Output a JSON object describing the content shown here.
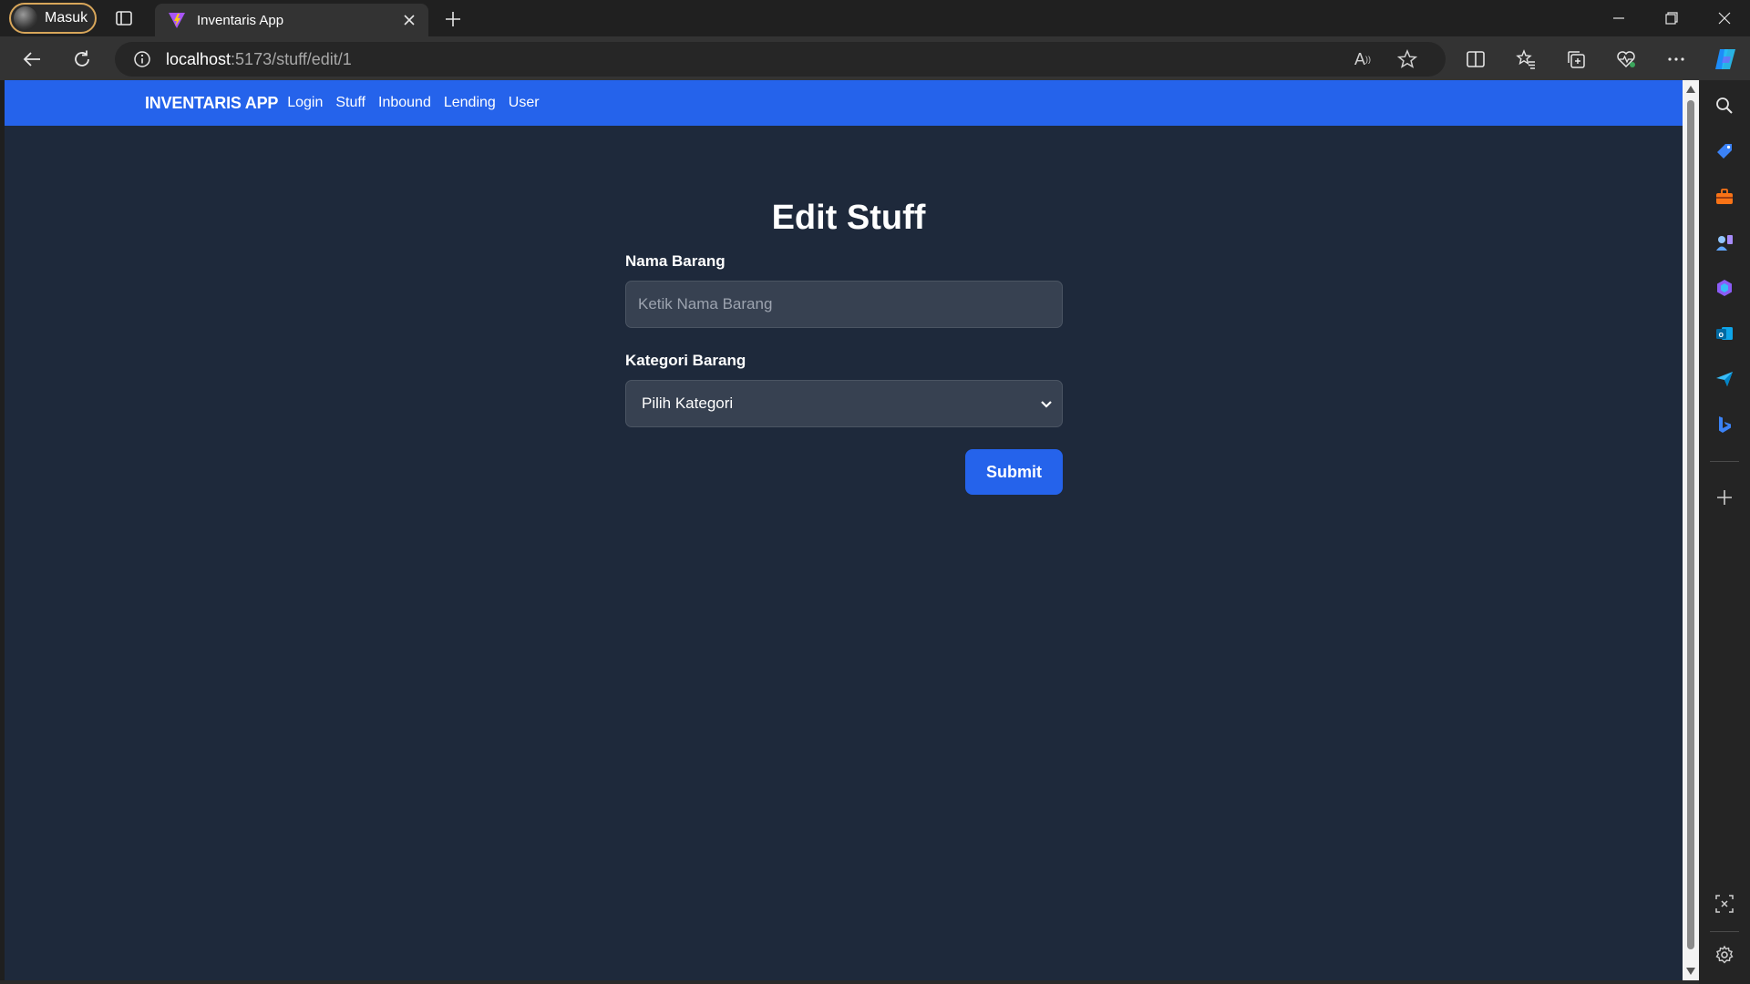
{
  "browser": {
    "profile_label": "Masuk",
    "tab_title": "Inventaris App",
    "url_host": "localhost",
    "url_path": ":5173/stuff/edit/1",
    "read_aloud_label": "A"
  },
  "navbar": {
    "brand": "INVENTARIS APP",
    "links": [
      "Login",
      "Stuff",
      "Inbound",
      "Lending",
      "User"
    ]
  },
  "form": {
    "title": "Edit Stuff",
    "name_label": "Nama Barang",
    "name_placeholder": "Ketik Nama Barang",
    "name_value": "",
    "category_label": "Kategori Barang",
    "category_selected": "Pilih Kategori",
    "submit_label": "Submit"
  },
  "colors": {
    "navbar": "#2563eb",
    "page_bg": "#1e293b",
    "input_bg": "#374151",
    "button": "#2563eb"
  }
}
